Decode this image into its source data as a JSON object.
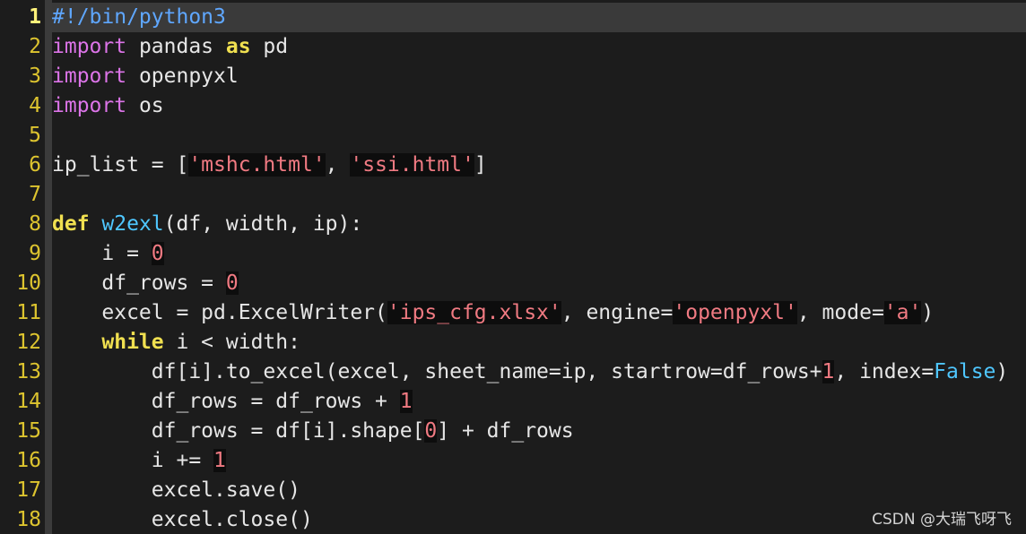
{
  "editor": {
    "current_line": 1,
    "lines": [
      {
        "n": "1",
        "tokens": [
          {
            "t": "#!/bin/python3",
            "k": "comment"
          }
        ]
      },
      {
        "n": "2",
        "tokens": [
          {
            "t": "import",
            "k": "keyword"
          },
          {
            "t": " pandas ",
            "k": "plain"
          },
          {
            "t": "as",
            "k": "bold"
          },
          {
            "t": " pd",
            "k": "plain"
          }
        ]
      },
      {
        "n": "3",
        "tokens": [
          {
            "t": "import",
            "k": "keyword"
          },
          {
            "t": " openpyxl",
            "k": "plain"
          }
        ]
      },
      {
        "n": "4",
        "tokens": [
          {
            "t": "import",
            "k": "keyword"
          },
          {
            "t": " os",
            "k": "plain"
          }
        ]
      },
      {
        "n": "5",
        "tokens": []
      },
      {
        "n": "6",
        "tokens": [
          {
            "t": "ip_list = [",
            "k": "plain"
          },
          {
            "t": "'mshc.html'",
            "k": "string"
          },
          {
            "t": ", ",
            "k": "plain"
          },
          {
            "t": "'ssi.html'",
            "k": "string"
          },
          {
            "t": "]",
            "k": "plain"
          }
        ]
      },
      {
        "n": "7",
        "tokens": []
      },
      {
        "n": "8",
        "tokens": [
          {
            "t": "def",
            "k": "bold"
          },
          {
            "t": " ",
            "k": "plain"
          },
          {
            "t": "w2exl",
            "k": "func"
          },
          {
            "t": "(df, width, ip):",
            "k": "plain"
          }
        ]
      },
      {
        "n": "9",
        "tokens": [
          {
            "t": "    i = ",
            "k": "plain"
          },
          {
            "t": "0",
            "k": "number"
          }
        ]
      },
      {
        "n": "10",
        "tokens": [
          {
            "t": "    df_rows = ",
            "k": "plain"
          },
          {
            "t": "0",
            "k": "number"
          }
        ]
      },
      {
        "n": "11",
        "tokens": [
          {
            "t": "    excel = pd.ExcelWriter(",
            "k": "plain"
          },
          {
            "t": "'ips_cfg.xlsx'",
            "k": "string"
          },
          {
            "t": ", engine=",
            "k": "plain"
          },
          {
            "t": "'openpyxl'",
            "k": "string"
          },
          {
            "t": ", mode=",
            "k": "plain"
          },
          {
            "t": "'a'",
            "k": "string"
          },
          {
            "t": ")",
            "k": "plain"
          }
        ]
      },
      {
        "n": "12",
        "tokens": [
          {
            "t": "    ",
            "k": "plain"
          },
          {
            "t": "while",
            "k": "bold"
          },
          {
            "t": " i < width:",
            "k": "plain"
          }
        ]
      },
      {
        "n": "13",
        "tokens": [
          {
            "t": "        df[i].to_excel(excel, sheet_name=ip, startrow=df_rows+",
            "k": "plain"
          },
          {
            "t": "1",
            "k": "number"
          },
          {
            "t": ", index=",
            "k": "plain"
          },
          {
            "t": "False",
            "k": "const"
          },
          {
            "t": ")",
            "k": "plain"
          }
        ]
      },
      {
        "n": "14",
        "tokens": [
          {
            "t": "        df_rows = df_rows + ",
            "k": "plain"
          },
          {
            "t": "1",
            "k": "number"
          }
        ]
      },
      {
        "n": "15",
        "tokens": [
          {
            "t": "        df_rows = df[i].shape[",
            "k": "plain"
          },
          {
            "t": "0",
            "k": "number"
          },
          {
            "t": "] + df_rows",
            "k": "plain"
          }
        ]
      },
      {
        "n": "16",
        "tokens": [
          {
            "t": "        i += ",
            "k": "plain"
          },
          {
            "t": "1",
            "k": "number"
          }
        ]
      },
      {
        "n": "17",
        "tokens": [
          {
            "t": "        excel.save()",
            "k": "plain"
          }
        ]
      },
      {
        "n": "18",
        "tokens": [
          {
            "t": "        excel.close()",
            "k": "plain"
          }
        ]
      }
    ]
  },
  "watermark": "CSDN @大瑞飞呀飞"
}
